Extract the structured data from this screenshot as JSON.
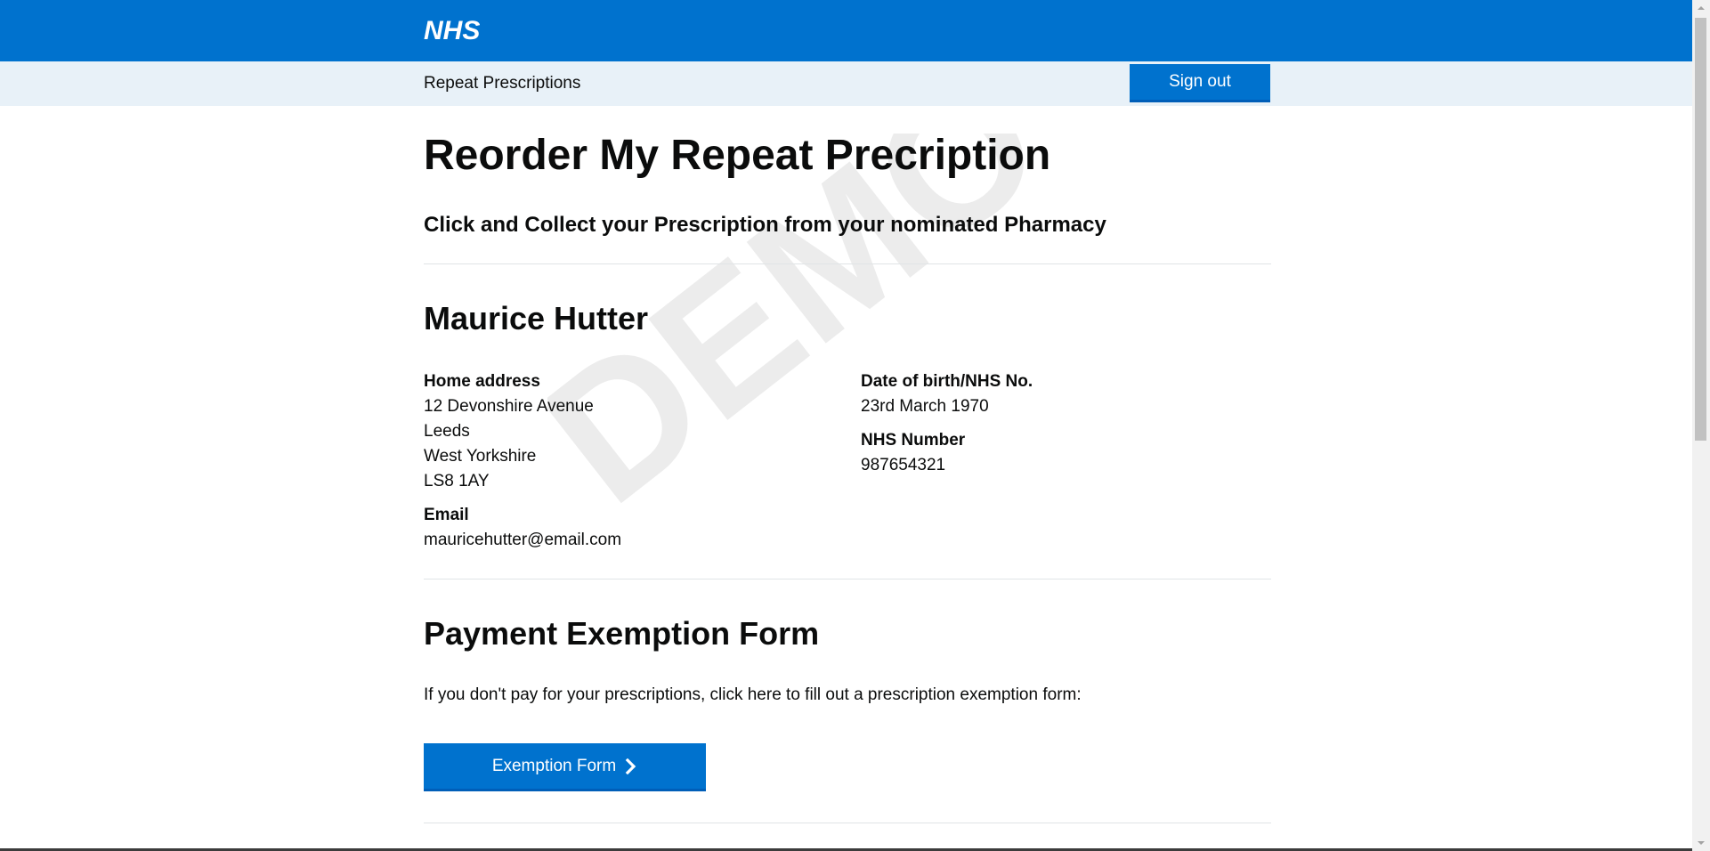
{
  "header": {
    "logo_text": "NHS",
    "brand_color": "#0072ce",
    "service_name": "Repeat Prescriptions",
    "signout_label": "Sign out"
  },
  "main": {
    "title": "Reorder My Repeat Precription",
    "subtitle": "Click and Collect your Prescription from your nominated Pharmacy",
    "watermark_text": "DEMO"
  },
  "patient": {
    "name": "Maurice Hutter",
    "home_address_label": "Home address",
    "address_lines": [
      "12 Devonshire Avenue",
      "Leeds",
      "West Yorkshire",
      "LS8 1AY"
    ],
    "email_label": "Email",
    "email": "mauricehutter@email.com",
    "dob_label": "Date of birth/NHS No.",
    "dob": "23rd March 1970",
    "nhs_number_label": "NHS Number",
    "nhs_number": "987654321"
  },
  "exemption": {
    "title": "Payment Exemption Form",
    "info": "If you don't pay for your prescriptions, click here to fill out a prescription exemption form:",
    "button_label": "Exemption Form",
    "button_icon": "chevron-right-icon"
  }
}
